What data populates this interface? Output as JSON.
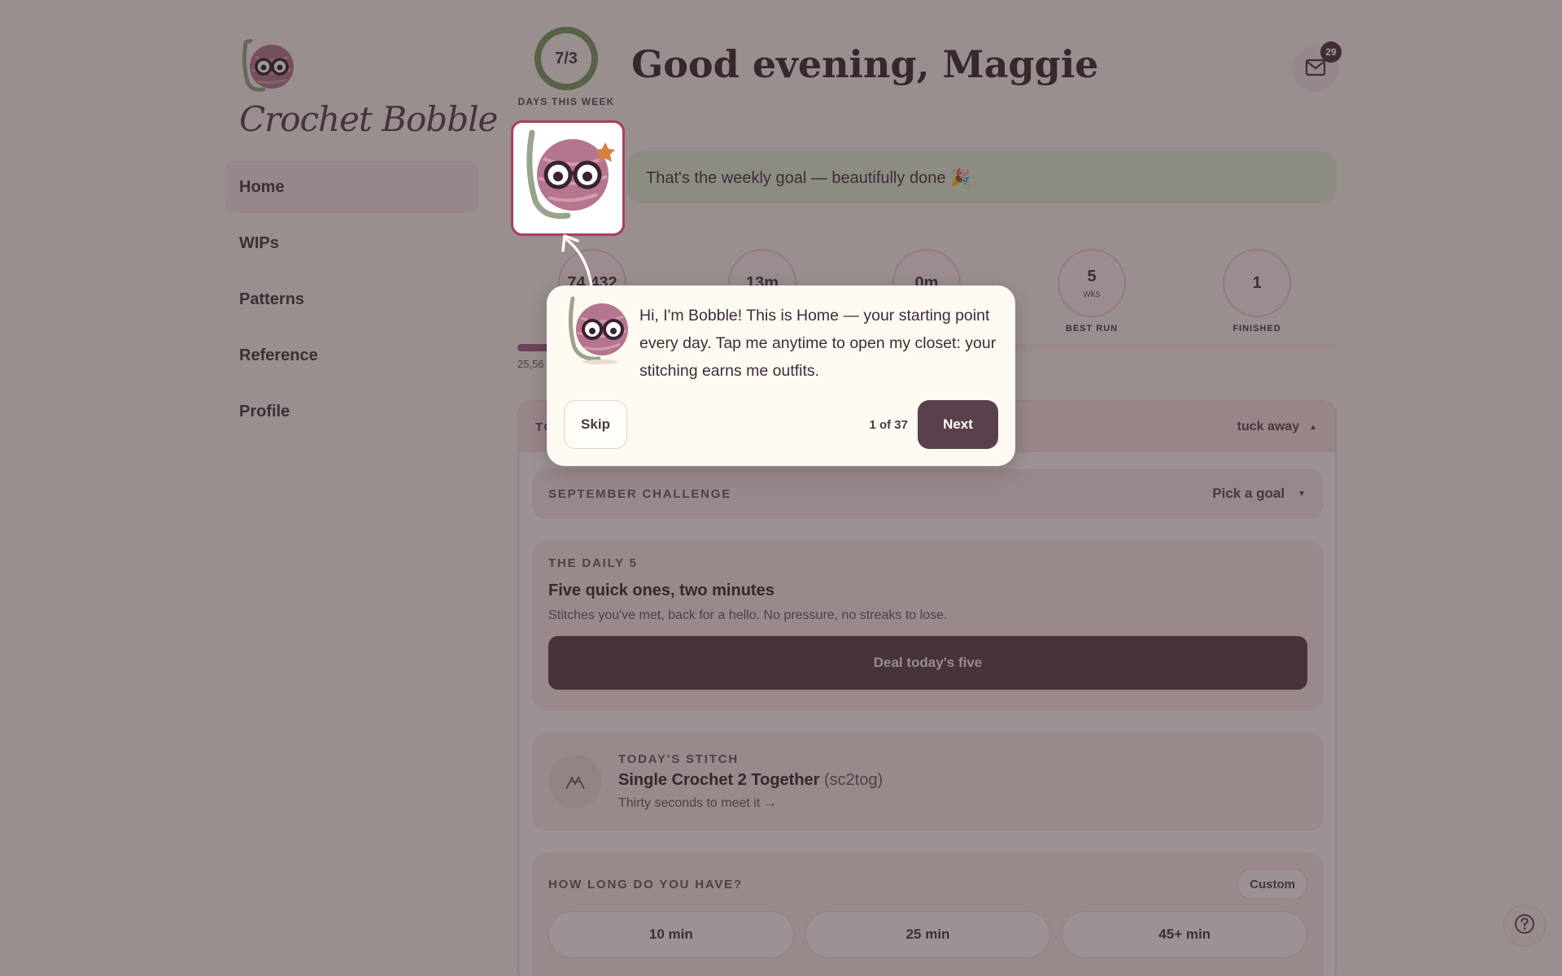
{
  "brand": {
    "name": "Crochet Bobble"
  },
  "sidebar": {
    "items": [
      {
        "label": "Home"
      },
      {
        "label": "WIPs"
      },
      {
        "label": "Patterns"
      },
      {
        "label": "Reference"
      },
      {
        "label": "Profile"
      }
    ]
  },
  "header": {
    "ring_value": "7/3",
    "ring_fraction": 1.0,
    "ring_label": "DAYS THIS WEEK",
    "greeting": "Good evening, Maggie",
    "mail_badge": "29"
  },
  "goal_banner": {
    "text": "That's the weekly goal — beautifully done 🎉"
  },
  "stats": [
    {
      "value": "74,432",
      "unit": "",
      "label": ""
    },
    {
      "value": "13m",
      "unit": "",
      "label": ""
    },
    {
      "value": "0m",
      "unit": "",
      "label": ""
    },
    {
      "value": "5",
      "unit": "wks",
      "label": "BEST RUN"
    },
    {
      "value": "1",
      "unit": "",
      "label": "FINISHED"
    }
  ],
  "progress": {
    "fraction": 0.6,
    "caption": "25,56"
  },
  "panel": {
    "title": "TO",
    "tuck_label": "tuck away",
    "challenge": {
      "label": "SEPTEMBER CHALLENGE",
      "pick_label": "Pick a goal"
    },
    "daily": {
      "eyebrow": "THE DAILY 5",
      "title": "Five quick ones, two minutes",
      "subtitle": "Stitches you've met, back for a hello. No pressure, no streaks to lose.",
      "button": "Deal today's five"
    },
    "stitch": {
      "eyebrow": "TODAY'S STITCH",
      "name": "Single Crochet 2 Together",
      "abbr": "(sc2tog)",
      "link": "Thirty seconds to meet it →"
    },
    "howlong": {
      "eyebrow": "HOW LONG DO YOU HAVE?",
      "custom": "Custom",
      "options": [
        "10 min",
        "25 min",
        "45+ min"
      ]
    }
  },
  "tour": {
    "text": "Hi, I'm Bobble! This is Home — your starting point every day. Tap me anytime to open my closet: your stitching earns me outfits.",
    "skip": "Skip",
    "step": "1 of 37",
    "next": "Next"
  },
  "colors": {
    "accent": "#5a404c",
    "ring": "#7a9a62",
    "frame": "#a8405e",
    "overlay": "#302428"
  }
}
